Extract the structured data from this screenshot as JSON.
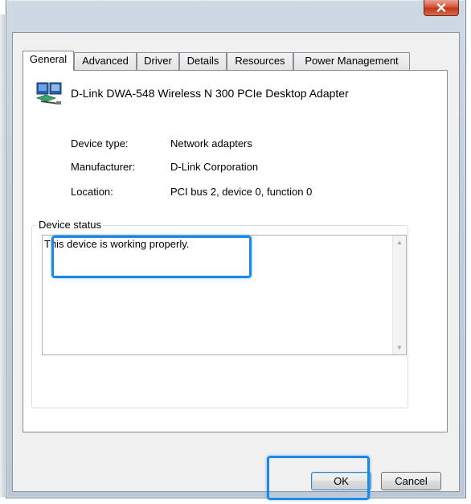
{
  "window": {
    "close_label": "x"
  },
  "tabs": [
    {
      "label": "General",
      "active": true
    },
    {
      "label": "Advanced",
      "active": false
    },
    {
      "label": "Driver",
      "active": false
    },
    {
      "label": "Details",
      "active": false
    },
    {
      "label": "Resources",
      "active": false
    },
    {
      "label": "Power Management",
      "active": false
    }
  ],
  "device": {
    "name": "D-Link DWA-548 Wireless N 300 PCIe Desktop Adapter",
    "icon": "network-adapter-icon",
    "properties": [
      {
        "label": "Device type:",
        "value": "Network adapters"
      },
      {
        "label": "Manufacturer:",
        "value": "D-Link Corporation"
      },
      {
        "label": "Location:",
        "value": "PCI bus 2, device 0, function 0"
      }
    ]
  },
  "status": {
    "group_title": "Device status",
    "text": "This device is working properly."
  },
  "buttons": {
    "ok": "OK",
    "cancel": "Cancel"
  },
  "colors": {
    "highlight": "#1e88e5",
    "close_button": "#c0371c"
  }
}
